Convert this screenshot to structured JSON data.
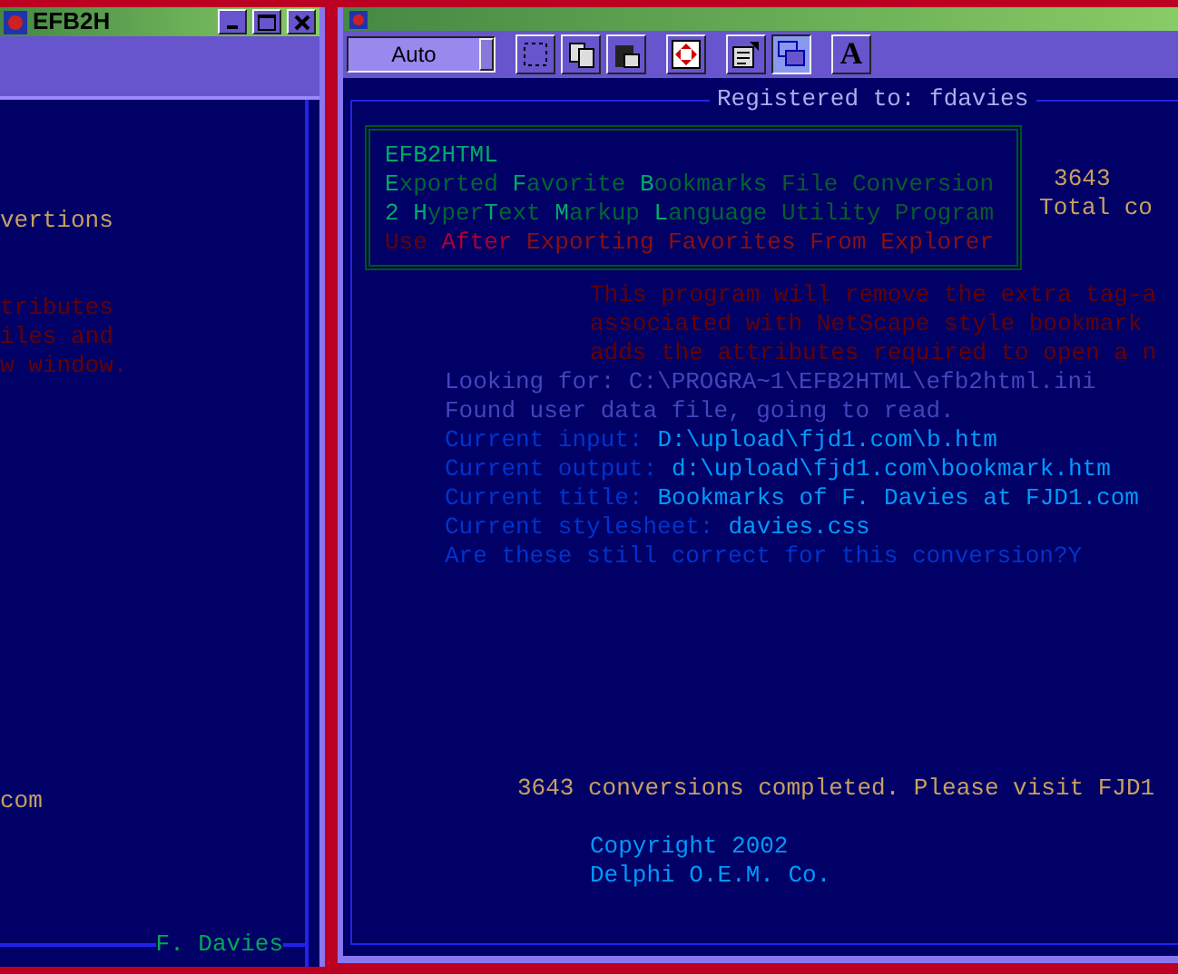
{
  "left_window": {
    "title": "EFB2H",
    "lines": [
      {
        "kind": "stat",
        "text": "vertions"
      },
      {
        "kind": "note",
        "text": "tributes"
      },
      {
        "kind": "note",
        "text": "iles and"
      },
      {
        "kind": "note",
        "text": "w window."
      }
    ],
    "status": "com",
    "footer": "F. Davies"
  },
  "right_window": {
    "toolbar": {
      "dropdown": "Auto",
      "buttons": [
        {
          "kind": "select",
          "selected": false
        },
        {
          "kind": "copy",
          "selected": false
        },
        {
          "kind": "paste",
          "selected": false
        },
        {
          "kind": "move",
          "selected": false
        },
        {
          "kind": "properties",
          "selected": false
        },
        {
          "kind": "window",
          "selected": true
        },
        {
          "kind": "font",
          "selected": false,
          "label": "A"
        }
      ]
    },
    "registered": "Registered to: fdavies",
    "banner": [
      "**EFB2HTML**",
      "**E**xported **F**avorite **B**ookmarks *File Conversion*",
      "**2 H**yper**T**ext **M**arkup **L**anguage *Utility Program*",
      "Use **After** *Exporting Favorites From Explorer*"
    ],
    "stats": {
      "count": "3643",
      "label": "Total co"
    },
    "description": [
      "This program will remove the extra tag-a",
      "associated with NetScape style bookmark",
      "adds the attributes required to open a n"
    ],
    "log": [
      {
        "kind": "info",
        "label": "Looking for: C:\\PROGRA~1\\EFB2HTML\\efb2html.ini"
      },
      {
        "kind": "info",
        "label": "Found user data file, going to read."
      },
      {
        "kind": "setting",
        "label": "Current input:",
        "value": "D:\\upload\\fjd1.com\\b.htm"
      },
      {
        "kind": "setting",
        "label": "Current output:",
        "value": "d:\\upload\\fjd1.com\\bookmark.htm"
      },
      {
        "kind": "setting",
        "label": "Current title:",
        "value": "Bookmarks of F. Davies at FJD1.com"
      },
      {
        "kind": "setting",
        "label": "Current stylesheet:",
        "value": "davies.css"
      },
      {
        "kind": "prompt",
        "label": "Are these still correct for this conversion?Y"
      }
    ],
    "summary": "3643 conversions completed. Please visit FJD1",
    "credits": [
      "Copyright 2002",
      "Delphi O.E.M. Co."
    ]
  }
}
